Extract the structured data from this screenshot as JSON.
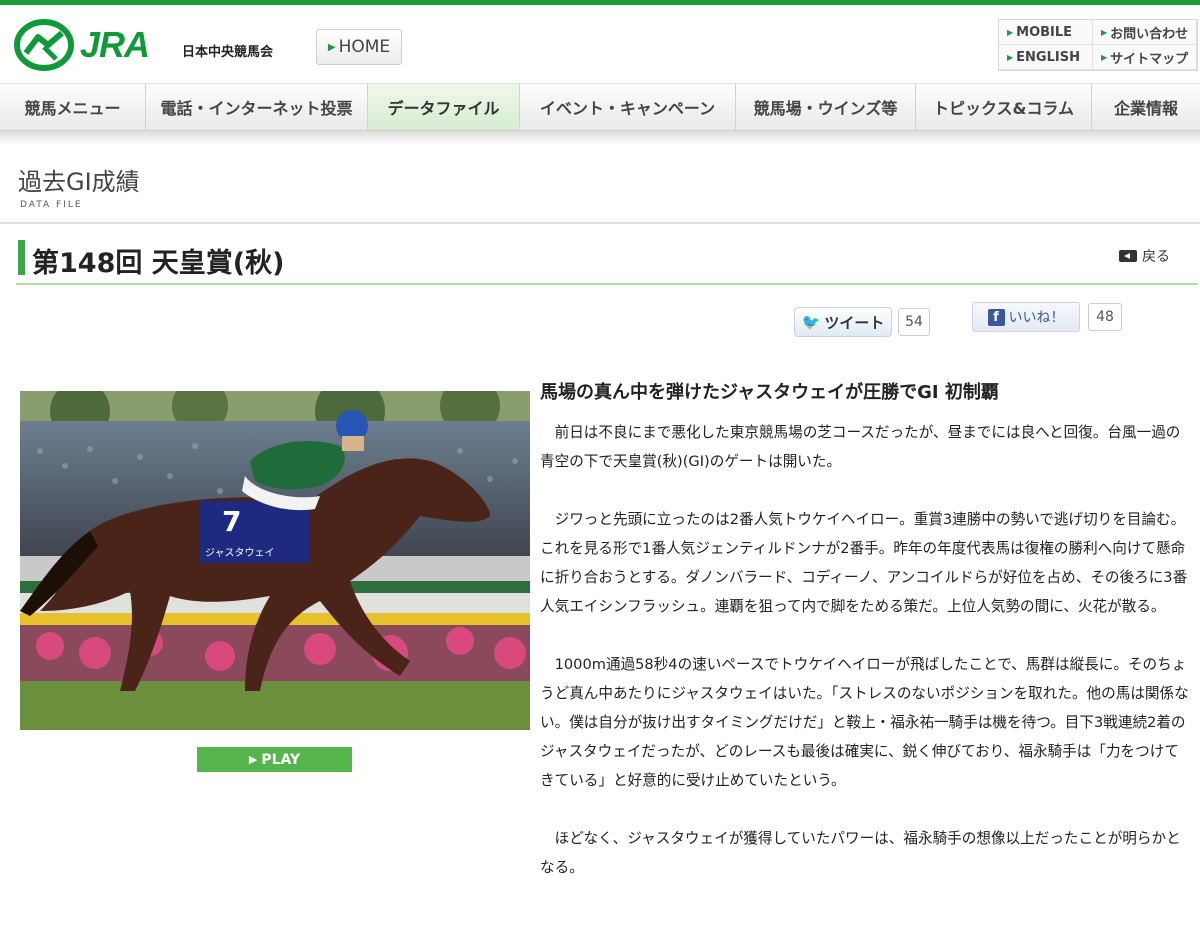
{
  "header": {
    "logo_text": "JRA",
    "org_name": "日本中央競馬会",
    "home_label": "HOME",
    "util_links": [
      "MOBILE",
      "お問い合わせ",
      "ENGLISH",
      "サイトマップ"
    ]
  },
  "nav": {
    "items": [
      "競馬メニュー",
      "電話・インターネット投票",
      "データファイル",
      "イベント・キャンペーン",
      "競馬場・ウインズ等",
      "トピックス&コラム",
      "企業情報"
    ],
    "active": "データファイル"
  },
  "section": {
    "title": "過去GI成績",
    "subtitle": "DATA FILE"
  },
  "race": {
    "title": "第148回 天皇賞(秋)",
    "back_label": "戻る"
  },
  "social": {
    "tweet_label": "ツイート",
    "tweet_count": "54",
    "like_label": "いいね！",
    "like_count": "48"
  },
  "media": {
    "play_label": "PLAY",
    "saddle_number": "7",
    "horse_name": "ジャスタウェイ"
  },
  "article": {
    "headline": "馬場の真ん中を弾けたジャスタウェイが圧勝でGI 初制覇",
    "paragraphs": [
      "前日は不良にまで悪化した東京競馬場の芝コースだったが、昼までには良へと回復。台風一過の青空の下で天皇賞(秋)(GI)のゲートは開いた。",
      "ジワっと先頭に立ったのは2番人気トウケイヘイロー。重賞3連勝中の勢いで逃げ切りを目論む。これを見る形で1番人気ジェンティルドンナが2番手。昨年の年度代表馬は復権の勝利へ向けて懸命に折り合おうとする。ダノンバラード、コディーノ、アンコイルドらが好位を占め、その後ろに3番人気エイシンフラッシュ。連覇を狙って内で脚をためる策だ。上位人気勢の間に、火花が散る。",
      "1000m通過58秒4の速いペースでトウケイヘイローが飛ばしたことで、馬群は縦長に。そのちょうど真ん中あたりにジャスタウェイはいた。「ストレスのないポジションを取れた。他の馬は関係ない。僕は自分が抜け出すタイミングだけだ」と鞍上・福永祐一騎手は機を待つ。目下3戦連続2着のジャスタウェイだったが、どのレースも最後は確実に、鋭く伸びており、福永騎手は「力をつけてきている」と好意的に受け止めていたという。",
      "ほどなく、ジャスタウェイが獲得していたパワーは、福永騎手の想像以上だったことが明らかとなる。"
    ]
  },
  "colors": {
    "brand_green": "#1c9a3c",
    "accent_rule": "#b6dda9",
    "play_green": "#55b44b"
  }
}
